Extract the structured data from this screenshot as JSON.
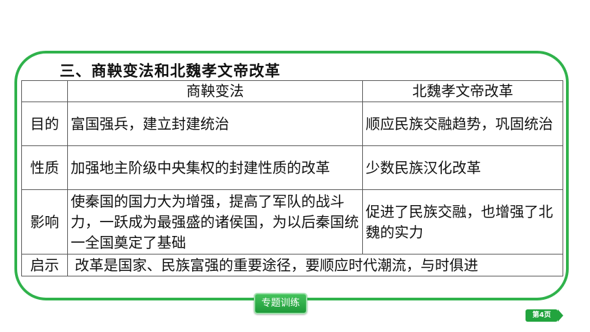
{
  "section_title": "三、商鞅变法和北魏孝文帝改革",
  "table": {
    "headers": [
      "",
      "商鞅变法",
      "北魏孝文帝改革"
    ],
    "rows": [
      {
        "label": "目的",
        "shang_yang": "富国强兵，建立封建统治",
        "xiaowen": "顺应民族交融趋势，巩固统治"
      },
      {
        "label": "性质",
        "shang_yang": "加强地主阶级中央集权的封建性质的改革",
        "xiaowen": "少数民族汉化改革"
      },
      {
        "label": "影响",
        "shang_yang": "使秦国的国力大为增强，提高了军队的战斗力，一跃成为最强盛的诸侯国，为以后秦国统一全国奠定了基础",
        "xiaowen": "促进了民族交融，也增强了北魏的实力"
      }
    ],
    "footer": {
      "label": "启示",
      "text": "改革是国家、民族富强的重要途径，要顺应时代潮流，与时俱进"
    }
  },
  "button_label": "专题训练",
  "page_indicator": "第4页",
  "colors": {
    "accent_green": "#2fb24b"
  }
}
